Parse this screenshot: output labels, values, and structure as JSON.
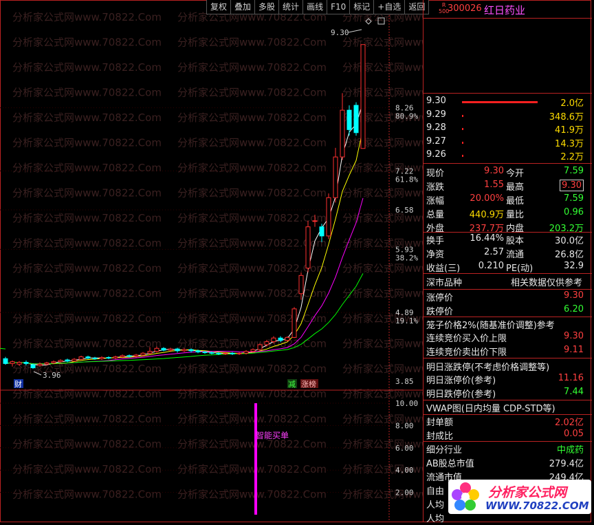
{
  "toolbar": {
    "buttons": [
      "复权",
      "叠加",
      "多股",
      "统计",
      "画线",
      "F10",
      "标记",
      "+自选",
      "返回"
    ]
  },
  "stock": {
    "badge_top": "R",
    "badge_bottom": "500",
    "code": "300026",
    "name": "红日药业"
  },
  "watermark": "分析家公式网www.70822.Com",
  "price_axis": {
    "labels": [
      "8.26",
      "80.9%",
      "7.22",
      "61.8%",
      "6.58",
      "5.93",
      "38.2%",
      "4.89",
      "19.1%",
      "3.85"
    ],
    "high_mark": "9.30",
    "low_mark": "3.96"
  },
  "markers": {
    "cai": "财",
    "jian": "减",
    "zhangbang": "涨榜"
  },
  "indicator": {
    "axis": [
      "10.00",
      "8.00",
      "6.00",
      "4.00",
      "2.00"
    ],
    "label": "智能买单",
    "bar_value": 10
  },
  "orderbook": [
    {
      "price": "9.30",
      "vol": "2.0亿",
      "fill": 1.0
    },
    {
      "price": "9.29",
      "vol": "348.6万",
      "fill": 0.02
    },
    {
      "price": "9.28",
      "vol": "41.9万",
      "fill": 0.02
    },
    {
      "price": "9.27",
      "vol": "14.3万",
      "fill": 0.02
    },
    {
      "price": "9.26",
      "vol": "2.2万",
      "fill": 0.02
    }
  ],
  "quote": [
    {
      "l1": "现价",
      "v1": "9.30",
      "l2": "今开",
      "v2": "7.59"
    },
    {
      "l1": "涨跌",
      "v1": "1.55",
      "l2": "最高",
      "v2": "9.30"
    },
    {
      "l1": "涨幅",
      "v1": "20.00%",
      "l2": "最低",
      "v2": "7.59"
    },
    {
      "l1": "总量",
      "v1": "440.9万",
      "l2": "量比",
      "v2": "0.96"
    },
    {
      "l1": "外盘",
      "v1": "237.7万",
      "l2": "内盘",
      "v2": "203.2万"
    }
  ],
  "quote2": [
    {
      "l1": "换手",
      "v1": "16.44%",
      "l2": "股本",
      "v2": "30.0亿"
    },
    {
      "l1": "净资",
      "v1": "2.57",
      "l2": "流通",
      "v2": "26.8亿"
    },
    {
      "l1": "收益(三)",
      "v1": "0.210",
      "l2": "PE(动)",
      "v2": "32.9"
    }
  ],
  "market": {
    "left": "深市品种",
    "right": "相关数据仅供参考"
  },
  "limits": [
    {
      "l": "涨停价",
      "v": "9.30"
    },
    {
      "l": "跌停价",
      "v": "6.20"
    }
  ],
  "cage": {
    "title": "笼子价格2%(随基准价调整)参考",
    "rows": [
      {
        "l": "连续竞价买入价上限",
        "v": "9.30"
      },
      {
        "l": "连续竞价卖出价下限",
        "v": "9.11"
      }
    ]
  },
  "tomorrow": {
    "title": "明日涨跌停(不考虑价格调整等)",
    "rows": [
      {
        "l": "明日涨停价(参考)",
        "v": "11.16"
      },
      {
        "l": "明日跌停价(参考)",
        "v": "7.44"
      }
    ]
  },
  "vwap": "VWAP图(日内均量 CDP-STD等)",
  "seal": [
    {
      "l": "封单额",
      "v": "2.02亿"
    },
    {
      "l": "封成比",
      "v": "0.05"
    }
  ],
  "industry": [
    {
      "l": "细分行业",
      "v": "中成药"
    },
    {
      "l": "AB股总市值",
      "v": "279.4亿"
    },
    {
      "l": "流通市值",
      "v": "249.4亿"
    },
    {
      "l": "自由",
      "v": ""
    },
    {
      "l": "人均",
      "v": ""
    },
    {
      "l": "人均",
      "v": ""
    }
  ],
  "logo": {
    "name": "分析家公式网",
    "url": "WWW.70822.COM"
  },
  "colors": {
    "up": "#ff3030",
    "down": "#00ffff",
    "ma1": "#ffffff",
    "ma2": "#ffff00",
    "ma3": "#ff00ff",
    "ma4": "#00ff00"
  }
}
